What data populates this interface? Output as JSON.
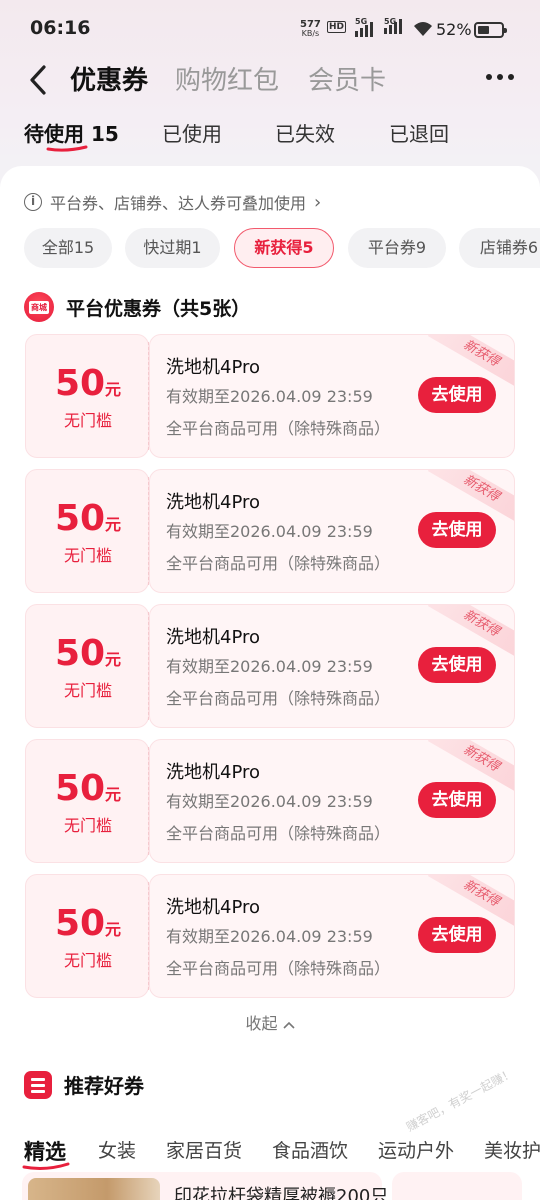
{
  "status_bar": {
    "time": "06:16",
    "net_speed_value": "577",
    "net_speed_unit": "KB/s",
    "hd_label": "HD",
    "sig1_label": "5G",
    "sig2_label": "5G",
    "battery_text": "52%",
    "battery_level": 0.52
  },
  "header": {
    "tabs": [
      {
        "label": "优惠券",
        "active": true
      },
      {
        "label": "购物红包",
        "active": false
      },
      {
        "label": "会员卡",
        "active": false
      }
    ]
  },
  "status_tabs": [
    {
      "label": "待使用 15",
      "active": true
    },
    {
      "label": "已使用",
      "active": false
    },
    {
      "label": "已失效",
      "active": false
    },
    {
      "label": "已退回",
      "active": false
    }
  ],
  "tip": {
    "text": "平台券、店铺券、达人券可叠加使用",
    "arrow": "›"
  },
  "filters": [
    {
      "label": "全部15",
      "active": false
    },
    {
      "label": "快过期1",
      "active": false
    },
    {
      "label": "新获得5",
      "active": true
    },
    {
      "label": "平台券9",
      "active": false
    },
    {
      "label": "店铺券6",
      "active": false
    }
  ],
  "section": {
    "icon_text": "商城",
    "title": "平台优惠券（共5张）"
  },
  "coupons": [
    {
      "amount": "50",
      "unit": "元",
      "condition": "无门槛",
      "title": "洗地机4Pro",
      "expiry": "有效期至2026.04.09 23:59",
      "scope": "全平台商品可用（除特殊商品）",
      "button": "去使用",
      "ribbon": "新获得"
    },
    {
      "amount": "50",
      "unit": "元",
      "condition": "无门槛",
      "title": "洗地机4Pro",
      "expiry": "有效期至2026.04.09 23:59",
      "scope": "全平台商品可用（除特殊商品）",
      "button": "去使用",
      "ribbon": "新获得"
    },
    {
      "amount": "50",
      "unit": "元",
      "condition": "无门槛",
      "title": "洗地机4Pro",
      "expiry": "有效期至2026.04.09 23:59",
      "scope": "全平台商品可用（除特殊商品）",
      "button": "去使用",
      "ribbon": "新获得"
    },
    {
      "amount": "50",
      "unit": "元",
      "condition": "无门槛",
      "title": "洗地机4Pro",
      "expiry": "有效期至2026.04.09 23:59",
      "scope": "全平台商品可用（除特殊商品）",
      "button": "去使用",
      "ribbon": "新获得"
    },
    {
      "amount": "50",
      "unit": "元",
      "condition": "无门槛",
      "title": "洗地机4Pro",
      "expiry": "有效期至2026.04.09 23:59",
      "scope": "全平台商品可用（除特殊商品）",
      "button": "去使用",
      "ribbon": "新获得"
    }
  ],
  "collapse": {
    "label": "收起",
    "icon": "chevron-up-icon"
  },
  "recommend": {
    "title": "推荐好券",
    "categories": [
      {
        "label": "精选",
        "active": true
      },
      {
        "label": "女装",
        "active": false
      },
      {
        "label": "家居百货",
        "active": false
      },
      {
        "label": "食品酒饮",
        "active": false
      },
      {
        "label": "运动户外",
        "active": false
      },
      {
        "label": "美妆护",
        "active": false
      }
    ],
    "card_text": "印花拉杆袋精厚被褥200只"
  },
  "watermark": "赚客吧，有奖一起赚！",
  "colors": {
    "accent": "#e8203d",
    "coupon_bg": "#fff5f6",
    "chip_bg": "#f2f2f4"
  }
}
